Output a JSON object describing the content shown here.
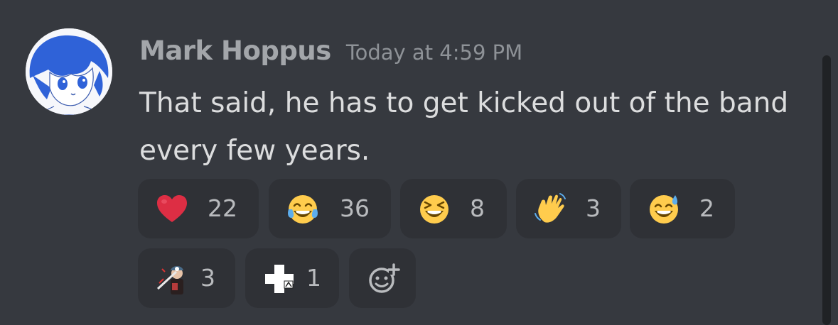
{
  "message": {
    "username": "Mark Hoppus",
    "timestamp": "Today at 4:59 PM",
    "content": "That said, he has to get kicked out of the band every few years."
  },
  "reactions": [
    {
      "emoji": "heart-emoji",
      "count": "22"
    },
    {
      "emoji": "joy-emoji",
      "count": "36"
    },
    {
      "emoji": "laughing-emoji",
      "count": "8"
    },
    {
      "emoji": "wave-emoji",
      "count": "3"
    },
    {
      "emoji": "sweat-smile-emoji",
      "count": "2"
    },
    {
      "emoji": "custom-guitar-emoji",
      "count": "3"
    },
    {
      "emoji": "custom-cross-emoji",
      "count": "1"
    }
  ],
  "add_reaction": {
    "icon": "add-reaction-icon"
  },
  "colors": {
    "background": "#36393f",
    "reaction_bg": "#2f3136",
    "username": "#a3a6aa",
    "text": "#dcddde",
    "muted": "#8e9297"
  }
}
